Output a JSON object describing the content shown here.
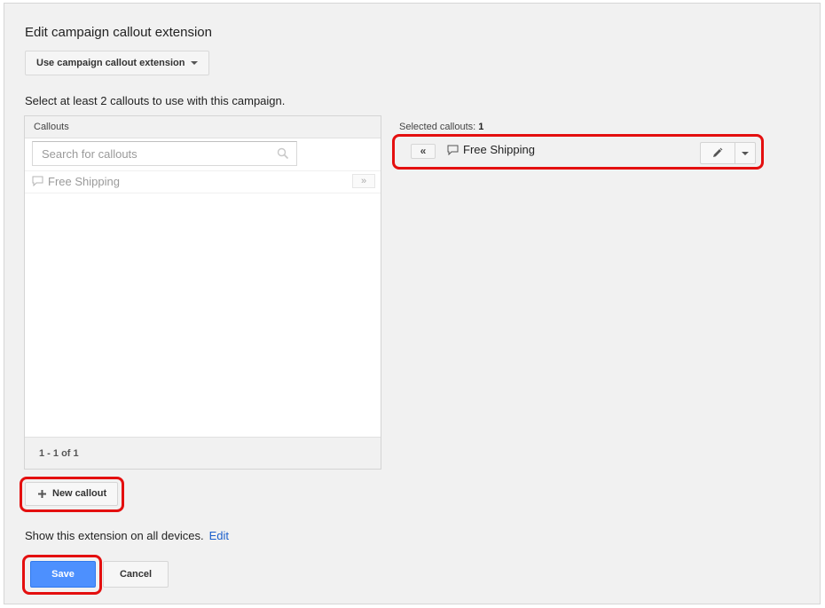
{
  "title": "Edit campaign callout extension",
  "mode_selector": {
    "label": "Use campaign callout extension"
  },
  "instruction": "Select at least 2 callouts to use with this campaign.",
  "available": {
    "header": "Callouts",
    "search_placeholder": "Search for callouts",
    "items": [
      {
        "label": "Free Shipping",
        "add_label": "»"
      }
    ],
    "pagination": "1 - 1 of 1"
  },
  "selected": {
    "label": "Selected callouts:",
    "count": "1",
    "items": [
      {
        "label": "Free Shipping",
        "remove_label": "«"
      }
    ]
  },
  "new_callout_label": "New callout",
  "devices": {
    "text": "Show this extension on all devices.",
    "edit_label": "Edit"
  },
  "actions": {
    "save_label": "Save",
    "cancel_label": "Cancel"
  },
  "colors": {
    "highlight": "#e40f0f",
    "primary": "#4d90fe",
    "link": "#1a5fcc"
  },
  "icons": [
    "search-icon",
    "speech-bubble-icon",
    "pencil-icon",
    "chevron-down-icon",
    "plus-icon"
  ]
}
